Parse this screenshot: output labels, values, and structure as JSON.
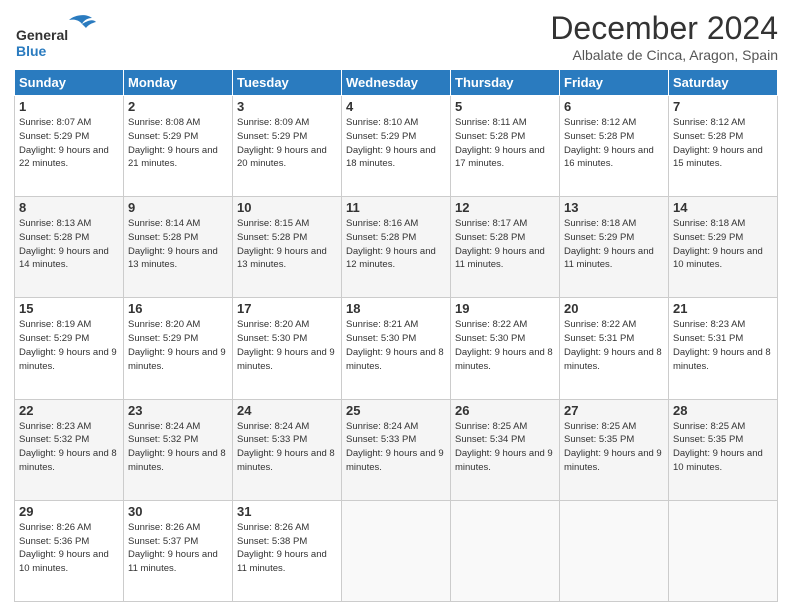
{
  "logo": {
    "general": "General",
    "blue": "Blue"
  },
  "header": {
    "title": "December 2024",
    "subtitle": "Albalate de Cinca, Aragon, Spain"
  },
  "weekdays": [
    "Sunday",
    "Monday",
    "Tuesday",
    "Wednesday",
    "Thursday",
    "Friday",
    "Saturday"
  ],
  "weeks": [
    [
      {
        "day": "1",
        "sunrise": "8:07 AM",
        "sunset": "5:29 PM",
        "daylight": "9 hours and 22 minutes."
      },
      {
        "day": "2",
        "sunrise": "8:08 AM",
        "sunset": "5:29 PM",
        "daylight": "9 hours and 21 minutes."
      },
      {
        "day": "3",
        "sunrise": "8:09 AM",
        "sunset": "5:29 PM",
        "daylight": "9 hours and 20 minutes."
      },
      {
        "day": "4",
        "sunrise": "8:10 AM",
        "sunset": "5:29 PM",
        "daylight": "9 hours and 18 minutes."
      },
      {
        "day": "5",
        "sunrise": "8:11 AM",
        "sunset": "5:28 PM",
        "daylight": "9 hours and 17 minutes."
      },
      {
        "day": "6",
        "sunrise": "8:12 AM",
        "sunset": "5:28 PM",
        "daylight": "9 hours and 16 minutes."
      },
      {
        "day": "7",
        "sunrise": "8:12 AM",
        "sunset": "5:28 PM",
        "daylight": "9 hours and 15 minutes."
      }
    ],
    [
      {
        "day": "8",
        "sunrise": "8:13 AM",
        "sunset": "5:28 PM",
        "daylight": "9 hours and 14 minutes."
      },
      {
        "day": "9",
        "sunrise": "8:14 AM",
        "sunset": "5:28 PM",
        "daylight": "9 hours and 13 minutes."
      },
      {
        "day": "10",
        "sunrise": "8:15 AM",
        "sunset": "5:28 PM",
        "daylight": "9 hours and 13 minutes."
      },
      {
        "day": "11",
        "sunrise": "8:16 AM",
        "sunset": "5:28 PM",
        "daylight": "9 hours and 12 minutes."
      },
      {
        "day": "12",
        "sunrise": "8:17 AM",
        "sunset": "5:28 PM",
        "daylight": "9 hours and 11 minutes."
      },
      {
        "day": "13",
        "sunrise": "8:18 AM",
        "sunset": "5:29 PM",
        "daylight": "9 hours and 11 minutes."
      },
      {
        "day": "14",
        "sunrise": "8:18 AM",
        "sunset": "5:29 PM",
        "daylight": "9 hours and 10 minutes."
      }
    ],
    [
      {
        "day": "15",
        "sunrise": "8:19 AM",
        "sunset": "5:29 PM",
        "daylight": "9 hours and 9 minutes."
      },
      {
        "day": "16",
        "sunrise": "8:20 AM",
        "sunset": "5:29 PM",
        "daylight": "9 hours and 9 minutes."
      },
      {
        "day": "17",
        "sunrise": "8:20 AM",
        "sunset": "5:30 PM",
        "daylight": "9 hours and 9 minutes."
      },
      {
        "day": "18",
        "sunrise": "8:21 AM",
        "sunset": "5:30 PM",
        "daylight": "9 hours and 8 minutes."
      },
      {
        "day": "19",
        "sunrise": "8:22 AM",
        "sunset": "5:30 PM",
        "daylight": "9 hours and 8 minutes."
      },
      {
        "day": "20",
        "sunrise": "8:22 AM",
        "sunset": "5:31 PM",
        "daylight": "9 hours and 8 minutes."
      },
      {
        "day": "21",
        "sunrise": "8:23 AM",
        "sunset": "5:31 PM",
        "daylight": "9 hours and 8 minutes."
      }
    ],
    [
      {
        "day": "22",
        "sunrise": "8:23 AM",
        "sunset": "5:32 PM",
        "daylight": "9 hours and 8 minutes."
      },
      {
        "day": "23",
        "sunrise": "8:24 AM",
        "sunset": "5:32 PM",
        "daylight": "9 hours and 8 minutes."
      },
      {
        "day": "24",
        "sunrise": "8:24 AM",
        "sunset": "5:33 PM",
        "daylight": "9 hours and 8 minutes."
      },
      {
        "day": "25",
        "sunrise": "8:24 AM",
        "sunset": "5:33 PM",
        "daylight": "9 hours and 9 minutes."
      },
      {
        "day": "26",
        "sunrise": "8:25 AM",
        "sunset": "5:34 PM",
        "daylight": "9 hours and 9 minutes."
      },
      {
        "day": "27",
        "sunrise": "8:25 AM",
        "sunset": "5:35 PM",
        "daylight": "9 hours and 9 minutes."
      },
      {
        "day": "28",
        "sunrise": "8:25 AM",
        "sunset": "5:35 PM",
        "daylight": "9 hours and 10 minutes."
      }
    ],
    [
      {
        "day": "29",
        "sunrise": "8:26 AM",
        "sunset": "5:36 PM",
        "daylight": "9 hours and 10 minutes."
      },
      {
        "day": "30",
        "sunrise": "8:26 AM",
        "sunset": "5:37 PM",
        "daylight": "9 hours and 11 minutes."
      },
      {
        "day": "31",
        "sunrise": "8:26 AM",
        "sunset": "5:38 PM",
        "daylight": "9 hours and 11 minutes."
      },
      null,
      null,
      null,
      null
    ]
  ]
}
